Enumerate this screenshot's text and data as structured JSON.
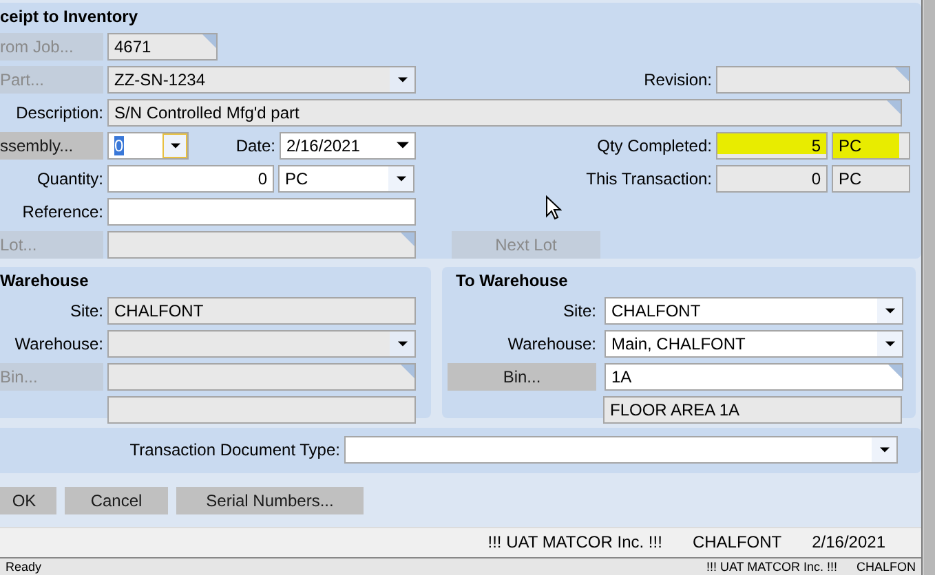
{
  "receipt": {
    "title": "ceipt to Inventory",
    "job": {
      "button": {
        "text": "rom Job...",
        "disabled": true
      },
      "field": {
        "kind": "lookup",
        "value": "4671",
        "editable": false
      }
    },
    "part": {
      "button": {
        "text": "Part...",
        "disabled": true
      },
      "field": {
        "kind": "combo",
        "value": "ZZ-SN-1234",
        "editable": false
      }
    },
    "revision": {
      "label": "Revision:",
      "field": {
        "kind": "lookup",
        "editable": false
      }
    },
    "description": {
      "label": "Description:",
      "field": {
        "kind": "lookup",
        "value": "S/N Controlled Mfg'd part",
        "editable": false
      }
    },
    "assembly": {
      "button": {
        "text": "ssembly...",
        "disabled": false
      },
      "field": {
        "kind": "combo",
        "value": "0",
        "editable": true,
        "focused": true
      }
    },
    "date": {
      "label": "Date:",
      "field": {
        "kind": "date",
        "value": "2/16/2021",
        "editable": true
      }
    },
    "qty_completed": {
      "label": "Qty Completed:",
      "field": {
        "kind": "number",
        "value": "5",
        "editable": false,
        "highlighted": true
      },
      "uom": {
        "kind": "text",
        "value": "PC",
        "editable": false,
        "highlighted": true
      }
    },
    "quantity": {
      "label": "Quantity:",
      "field": {
        "kind": "number",
        "value": "0",
        "editable": true
      },
      "uom": {
        "kind": "combo",
        "value": "PC",
        "editable": true
      }
    },
    "this_transaction": {
      "label": "This Transaction:",
      "field": {
        "kind": "number",
        "value": "0",
        "editable": false,
        "highlighted": false
      },
      "uom": {
        "kind": "text",
        "value": "PC",
        "editable": false,
        "highlighted": false
      }
    },
    "reference": {
      "label": "Reference:",
      "field": {
        "kind": "text",
        "editable": true
      }
    },
    "lot": {
      "button": {
        "text": "Lot...",
        "disabled": true
      },
      "field": {
        "kind": "lookup",
        "editable": false
      }
    },
    "next_lot": {
      "text": "Next Lot",
      "disabled": true
    }
  },
  "from_warehouse": {
    "title": "Warehouse",
    "site": {
      "label": "Site:",
      "field": {
        "kind": "text",
        "value": "CHALFONT",
        "editable": false
      }
    },
    "warehouse": {
      "label": "Warehouse:",
      "field": {
        "kind": "combo",
        "editable": false
      }
    },
    "bin": {
      "button": {
        "text": "Bin...",
        "disabled": true
      },
      "field": {
        "kind": "lookup",
        "editable": false
      }
    },
    "bin_description": {
      "kind": "text",
      "editable": false
    }
  },
  "to_warehouse": {
    "title": "To Warehouse",
    "site": {
      "label": "Site:",
      "field": {
        "kind": "combo",
        "value": "CHALFONT",
        "editable": true
      }
    },
    "warehouse": {
      "label": "Warehouse:",
      "field": {
        "kind": "combo",
        "value": "Main, CHALFONT",
        "editable": true
      }
    },
    "bin": {
      "button": {
        "text": "Bin...",
        "disabled": false
      },
      "field": {
        "kind": "lookup",
        "value": "1A",
        "editable": true
      }
    },
    "bin_description": {
      "kind": "text",
      "value": "FLOOR AREA 1A",
      "editable": false
    }
  },
  "document_type": {
    "label": "Transaction Document Type:",
    "field": {
      "kind": "combo",
      "editable": true
    }
  },
  "buttons": [
    {
      "text": "OK",
      "disabled": false
    },
    {
      "text": "Cancel",
      "disabled": false
    },
    {
      "text": "Serial Numbers...",
      "disabled": false
    }
  ],
  "status_bar": [
    "!!! UAT MATCOR Inc. !!!",
    "CHALFONT",
    "2/16/2021"
  ],
  "parent_status_bar": {
    "left": "Ready",
    "right": [
      "!!! UAT MATCOR Inc. !!!",
      "CHALFON"
    ]
  }
}
